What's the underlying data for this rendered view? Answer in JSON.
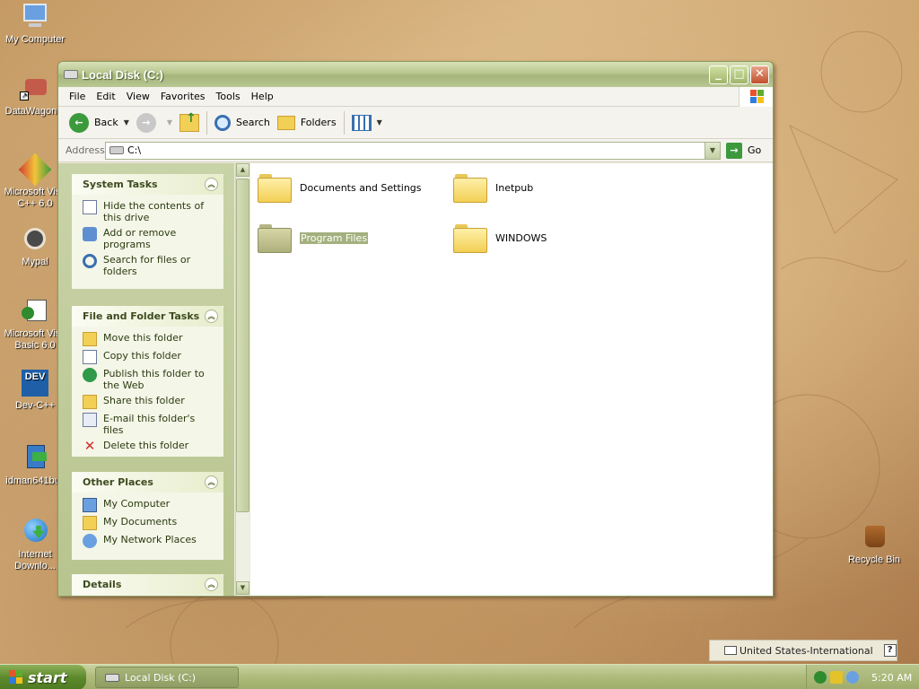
{
  "desktop": {
    "icons": [
      {
        "label": "My Computer",
        "icon": "computer-icon"
      },
      {
        "label": "DataWagon...",
        "icon": "datawagon-icon"
      },
      {
        "label": "Microsoft Visu C++ 6.0",
        "icon": "visual-cpp-icon"
      },
      {
        "label": "Mypal",
        "icon": "mypal-icon"
      },
      {
        "label": "Microsoft Visu Basic 6.0",
        "icon": "visual-basic-icon"
      },
      {
        "label": "Dev-C++",
        "icon": "dev-cpp-icon"
      },
      {
        "label": "idman641buil",
        "icon": "installer-icon"
      },
      {
        "label": "Internet Downlo...",
        "icon": "internet-download-icon"
      },
      {
        "label": "Recycle Bin",
        "icon": "recycle-bin-icon"
      }
    ],
    "dev_icon_text": "DEV"
  },
  "window": {
    "title": "Local Disk (C:)",
    "menu": [
      "File",
      "Edit",
      "View",
      "Favorites",
      "Tools",
      "Help"
    ],
    "toolbar": {
      "back": "Back",
      "search": "Search",
      "folders": "Folders"
    },
    "address": {
      "label": "Address",
      "value": "C:\\",
      "go": "Go"
    },
    "task_panels": {
      "system": {
        "title": "System Tasks",
        "items": [
          "Hide the contents of this drive",
          "Add or remove programs",
          "Search for files or folders"
        ]
      },
      "file_folder": {
        "title": "File and Folder Tasks",
        "items": [
          "Move this folder",
          "Copy this folder",
          "Publish this folder to the Web",
          "Share this folder",
          "E-mail this folder's files",
          "Delete this folder"
        ]
      },
      "other_places": {
        "title": "Other Places",
        "items": [
          "My Computer",
          "My Documents",
          "My Network Places"
        ]
      },
      "details": {
        "title": "Details"
      }
    },
    "files": [
      {
        "name": "Documents and Settings",
        "selected": false
      },
      {
        "name": "Inetpub",
        "selected": false
      },
      {
        "name": "Program Files",
        "selected": true
      },
      {
        "name": "WINDOWS",
        "selected": false
      }
    ]
  },
  "language_bar": {
    "text": "United States-International",
    "help": "?"
  },
  "taskbar": {
    "start": "start",
    "task_button": "Local Disk (C:)",
    "clock": "5:20 AM"
  },
  "colors": {
    "theme_olive": "#b7c58d",
    "selection": "#a4b07e"
  }
}
